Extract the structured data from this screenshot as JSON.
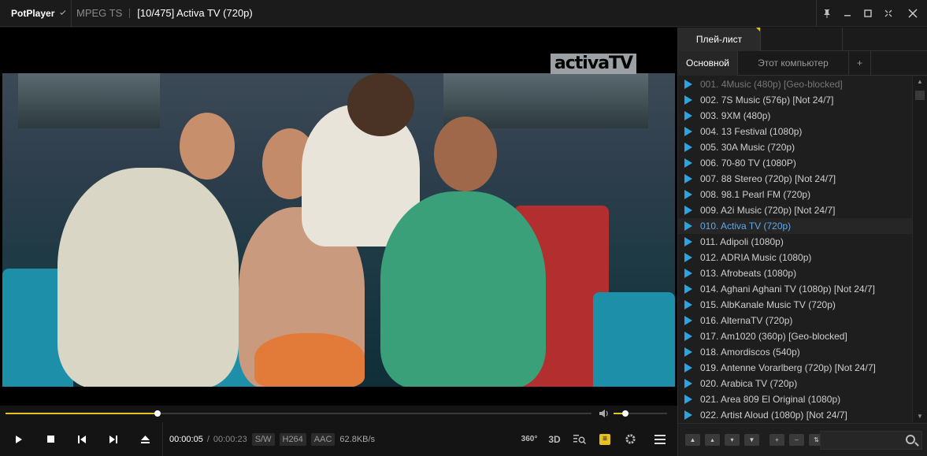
{
  "titlebar": {
    "app_name": "PotPlayer",
    "format": "MPEG TS",
    "title": "[10/475] Activa TV (720p)",
    "window_controls": [
      "pin-icon",
      "minimize-icon",
      "maximize-icon",
      "fullscreen-icon",
      "close-icon"
    ]
  },
  "video": {
    "logo_text": "activaTV"
  },
  "seek": {
    "progress": 0.26,
    "volume": 0.22
  },
  "controls": {
    "current_time": "00:00:05",
    "total_time": "00:00:23",
    "tags": [
      "S/W",
      "H264",
      "AAC"
    ],
    "bitrate": "62.8KB/s",
    "right_icons": [
      "360-icon",
      "3d-icon",
      "playlist-search-icon",
      "subtitle-icon",
      "settings-icon",
      "menu-icon"
    ],
    "label_360": "360°",
    "label_3d": "3D"
  },
  "playlist": {
    "tab_label": "Плей-лист",
    "subtabs": [
      "Основной",
      "Этот компьютер",
      "+"
    ],
    "items": [
      "001. 4Music (480p) [Geo-blocked]",
      "002. 7S Music (576p) [Not 24/7]",
      "003. 9XM (480p)",
      "004. 13 Festival (1080p)",
      "005. 30A Music (720p)",
      "006. 70-80 TV (1080P)",
      "007. 88 Stereo (720p) [Not 24/7]",
      "008. 98.1 Pearl FM (720p)",
      "009. A2i Music (720p) [Not 24/7]",
      "010. Activa TV (720p)",
      "011. Adipoli (1080p)",
      "012. ADRIA Music (1080p)",
      "013. Afrobeats (1080p)",
      "014. Aghani Aghani TV (1080p) [Not 24/7]",
      "015. AlbKanale Music TV (720p)",
      "016. AlternaTV (720p)",
      "017. Am1020 (360p) [Geo-blocked]",
      "018. Amordiscos (540p)",
      "019. Antenne Vorarlberg (720p) [Not 24/7]",
      "020. Arabica TV (720p)",
      "021. Area 809 El Original (1080p)",
      "022. Artist Aloud (1080p) [Not 24/7]"
    ],
    "current_index": 9,
    "dim_index": 0,
    "search_placeholder": ""
  },
  "colors": {
    "accent": "#e6c31c",
    "play_triangle": "#2aa3e0",
    "current_item": "#5fa8e8"
  }
}
